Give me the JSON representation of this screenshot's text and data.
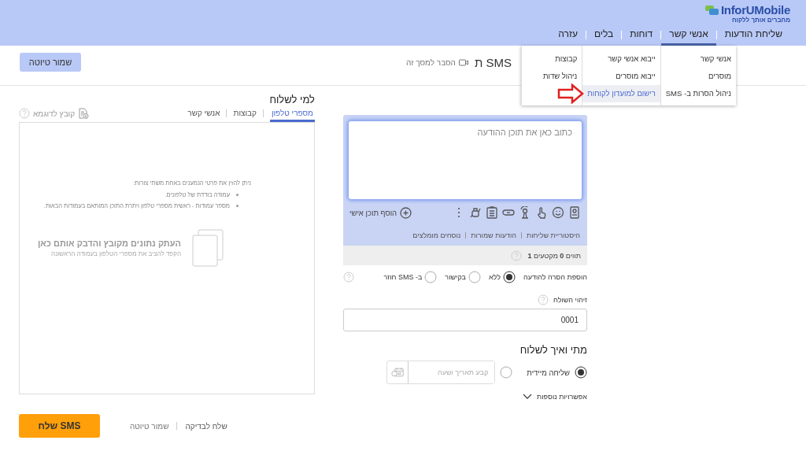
{
  "header": {
    "logo": "InforUMobile",
    "tagline": "מחברים אותך ללקוח",
    "nav": [
      {
        "label": "שליחת הודעות",
        "selected": false
      },
      {
        "label": "אנשי קשר",
        "selected": true
      },
      {
        "label": "דוחות",
        "selected": false
      },
      {
        "label": "בלים",
        "selected": false
      },
      {
        "label": "עזרה",
        "selected": false
      }
    ]
  },
  "dropdown": {
    "columns": [
      [
        {
          "label": "אנשי קשר",
          "selected": false
        },
        {
          "label": "מוסרים",
          "selected": false
        },
        {
          "label": "ניהול הסרות ב- SMS",
          "selected": false
        }
      ],
      [
        {
          "label": "ייבוא אנשי קשר",
          "selected": false
        },
        {
          "label": "ייבוא מוסרים",
          "selected": false
        },
        {
          "label": "רישום למועדון לקוחות",
          "selected": true
        }
      ],
      [
        {
          "label": "קבוצות",
          "selected": false
        },
        {
          "label": "ניהול שדות",
          "selected": false
        }
      ]
    ]
  },
  "page": {
    "title": "ת SMS",
    "help_link": "הסבר למסך זה",
    "save_draft": "שמור טיוטה"
  },
  "recipients": {
    "title": "למי לשלוח",
    "tabs": [
      {
        "label": "מספרי טלפון",
        "selected": true
      },
      {
        "label": "קבוצות",
        "selected": false
      },
      {
        "label": "אנשי קשר",
        "selected": false
      }
    ],
    "sample_file": "קובץ לדוגמא",
    "instructions": "ניתן להזין את פרטי הנמענים באחת משתי צורות:",
    "bullets": [
      "עמודה בודדת של טלפונים.",
      "מספר עמודות - ראשית מספרי טלפון ויתרת התוכן המותאם בעמודות הבאות."
    ],
    "paste_title": "העתק נתונים מקובץ והדבק אותם כאן",
    "paste_hint": "הקפד להציב את מספרי הטלפון בעמודה הראשונה"
  },
  "message": {
    "placeholder": "כתוב כאן את תוכן ההודעה",
    "add_personal": "הוסף תוכן אישי",
    "links": [
      "היסטוריית שליחות",
      "הודעות שמורות",
      "נוסחים מומלצים"
    ],
    "counter": "תווים **0** מקטעים **1**",
    "removal": {
      "label": "הוספת הסרה להודעה",
      "options": [
        {
          "label": "ללא",
          "selected": true
        },
        {
          "label": "בקישור",
          "selected": false
        },
        {
          "label": "ב- SMS חוזר",
          "selected": false
        }
      ]
    },
    "sender_label": "זיהוי השולח",
    "sender_value": "0001"
  },
  "schedule": {
    "title": "מתי ואיך לשלוח",
    "options": [
      {
        "kind": "label",
        "label": "שליחה מיידית",
        "selected": true
      },
      {
        "kind": "date",
        "placeholder": "קבע תאריך ושעה",
        "selected": false
      }
    ],
    "more": "אפשרויות נוספות"
  },
  "footer": {
    "send": "שלח SMS",
    "save_draft": "שמור טיוטה",
    "test": "שלח לבדיקה"
  }
}
